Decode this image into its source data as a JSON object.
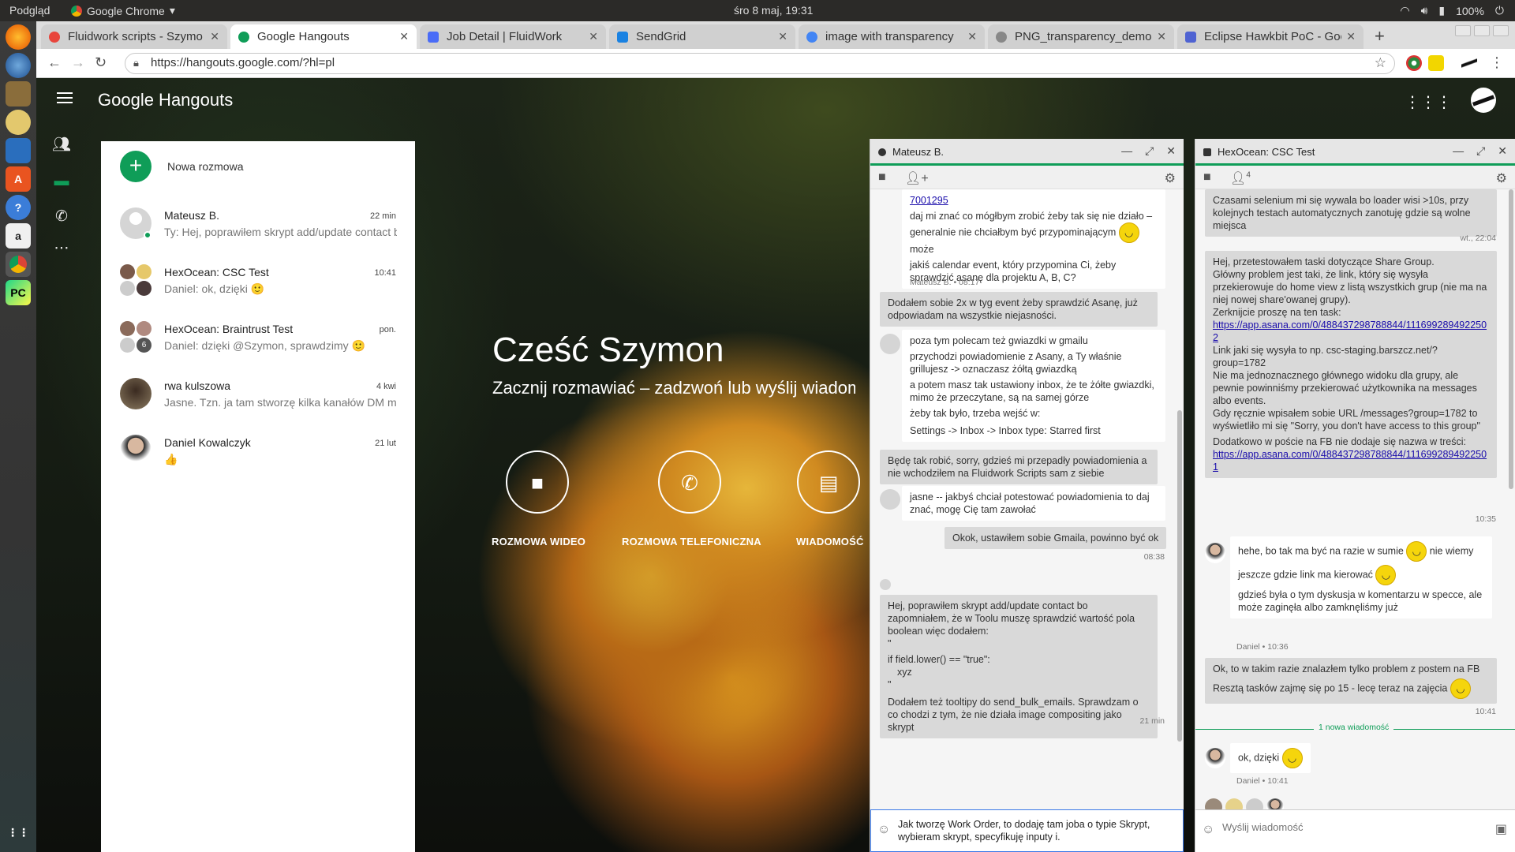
{
  "os": {
    "app_name": "Podgląd",
    "active_app": "Google Chrome",
    "clock": "śro 8 maj, 19:31",
    "battery": "100%"
  },
  "tabs": [
    {
      "title": "Fluidwork scripts - Szymo",
      "color": "#e8453c"
    },
    {
      "title": "Google Hangouts",
      "color": "#0f9d58"
    },
    {
      "title": "Job Detail | FluidWork",
      "color": "#4a6cf7"
    },
    {
      "title": "SendGrid",
      "color": "#1a82e2"
    },
    {
      "title": "image with transparency",
      "color": "#4285f4"
    },
    {
      "title": "PNG_transparency_demo",
      "color": "#888888"
    },
    {
      "title": "Eclipse Hawkbit PoC - Goo",
      "color": "#4f63d2"
    }
  ],
  "url": "https://hangouts.google.com/?hl=pl",
  "hangouts": {
    "logo": "Google Hangouts",
    "new_conversation": "Nowa rozmowa",
    "conversations": [
      {
        "name": "Mateusz B.",
        "time": "22 min",
        "snippet": "Ty: Hej, poprawiłem skrypt add/update contact bo zapomniałem"
      },
      {
        "name": "HexOcean: CSC Test",
        "time": "10:41",
        "snippet": "Daniel: ok, dzięki 🙂"
      },
      {
        "name": "HexOcean: Braintrust Test",
        "time": "pon.",
        "snippet": "Daniel: dzięki @Szymon, sprawdzimy 🙂"
      },
      {
        "name": "rwa kulszowa",
        "time": "4 kwi",
        "snippet": "Jasne. Tzn. ja tam stworzę kilka kanałów DM m"
      },
      {
        "name": "Daniel Kowalczyk",
        "time": "21 lut",
        "snippet": "👍"
      }
    ],
    "greeting": {
      "title": "Cześć Szymon",
      "subtitle": "Zacznij rozmawiać – zadzwoń lub wyślij wiadomość",
      "video": "ROZMOWA WIDEO",
      "phone": "ROZMOWA TELEFONICZNA",
      "message": "WIADOMOŚĆ"
    }
  },
  "chat1": {
    "title": "Mateusz B.",
    "messages": {
      "m1_link": "7001295",
      "m1_a": "daj mi znać co mógłbym zrobić żeby tak się nie działo – generalnie nie chciałbym być przypominającym",
      "m1_b": "może",
      "m1_c": "jakiś calendar event, który przypomina Ci, żeby sprawdzić asanę dla projektu A, B, C?",
      "m1_meta": "Mateusz B. • 08:17",
      "m2": "Dodałem sobie 2x w tyg event żeby sprawdzić Asanę, już odpowiadam na wszystkie niejasności.",
      "m3_a": "poza tym polecam też gwiazdki w gmailu",
      "m3_b": "przychodzi powiadomienie z Asany, a Ty właśnie grillujesz -> oznaczasz żółtą gwiazdką",
      "m3_c": "a potem masz tak ustawiony inbox, że te żółte gwiazdki, mimo że przeczytane, są na samej górze",
      "m3_d": "żeby tak było, trzeba wejść w:",
      "m3_e": "Settings -> Inbox -> Inbox type: Starred first",
      "m4": "Będę tak robić, sorry, gdzieś mi przepadły powiadomienia a nie wchodziłem na Fluidwork Scripts sam z siebie",
      "m5": "jasne -- jakbyś chciał potestować powiadomienia to daj znać, mogę Cię tam zawołać",
      "m6": "Okok, ustawiłem sobie Gmaila, powinno być ok",
      "m6_time": "08:38",
      "m7_a": "Hej, poprawiłem skrypt add/update contact bo zapomniałem, że w Toolu muszę sprawdzić wartość pola boolean więc dodałem:",
      "m7_b": "\"",
      "m7_c": "if field.lower() == \"true\":",
      "m7_d": "xyz",
      "m7_e": "\"",
      "m7_f": "Dodałem też tooltipy do send_bulk_emails. Sprawdzam o co chodzi z tym, że nie działa image compositing jako skrypt",
      "m7_time": "21 min"
    },
    "draft": "Jak tworzę Work Order, to dodaję tam joba o typie Skrypt, wybieram skrypt, specyfikuję inputy i."
  },
  "chat2": {
    "title": "HexOcean: CSC Test",
    "participants": "4",
    "messages": {
      "m1": "Czasami selenium mi się wywala bo loader wisi >10s, przy kolejnych testach automatycznych zanotuję gdzie są wolne miejsca",
      "m1_time": "wt., 22:04",
      "m2_a": "Hej, przetestowałem taski dotyczące Share Group.",
      "m2_b": "Główny problem jest taki, że link, który się wysyła przekierowuje do home view z listą wszystkich grup (nie ma na niej nowej share'owanej grupy).",
      "m2_c": "Zerknijcie proszę na ten task:",
      "m2_link1": "https://app.asana.com/0/488437298788844/1116992894922502",
      "m2_d": "Link jaki się wysyła to np. csc-staging.barszcz.net/?group=1782",
      "m2_e": "Nie ma jednoznacznego głównego widoku dla grupy, ale pewnie powinniśmy przekierować użytkownika na messages albo events.",
      "m2_f": "Gdy ręcznie wpisałem sobie URL /messages?group=1782 to wyświetliło mi się \"Sorry, you don't have access to this group\"",
      "m2_g": "Dodatkowo w poście na FB nie dodaje się nazwa w treści:",
      "m2_link2": "https://app.asana.com/0/488437298788844/1116992894922501",
      "m2_time": "10:35",
      "m3_a": "hehe, bo tak ma być na razie w sumie",
      "m3_b": "nie wiemy",
      "m3_c": "jeszcze gdzie link ma kierować",
      "m3_d": "gdzieś była o tym dyskusja w komentarzu w specce, ale może zaginęła albo zamknęliśmy już",
      "m3_meta": "Daniel • 10:36",
      "m4_a": "Ok, to w takim razie znalazłem tylko problem z postem na FB",
      "m4_b": "Resztą tasków zajmę się po 15 - lecę teraz na zajęcia",
      "m4_time": "10:41",
      "new_msg": "1 nowa wiadomość",
      "m5": "ok, dzięki",
      "m5_meta": "Daniel • 10:41"
    },
    "input_placeholder": "Wyślij wiadomość"
  },
  "colors": {
    "accent": "#0f9d58",
    "link": "#1a0dab"
  }
}
